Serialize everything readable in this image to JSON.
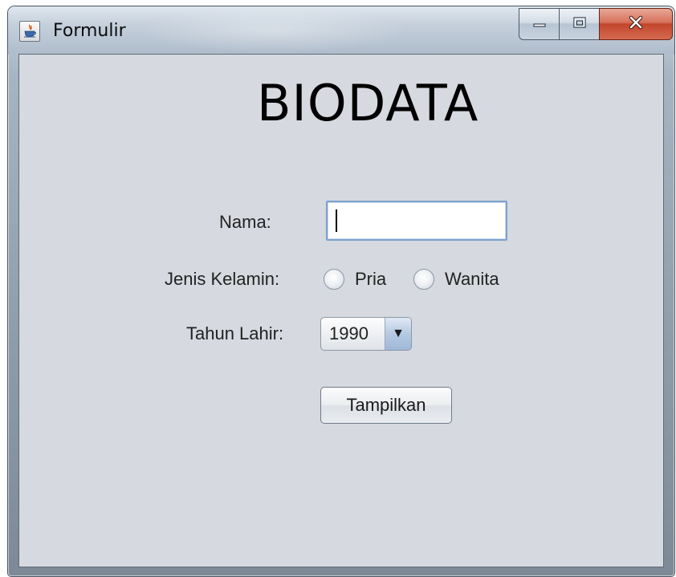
{
  "window": {
    "title": "Formulir",
    "app_icon": "java-cup-icon",
    "caption_buttons": [
      "minimize-icon",
      "maximize-icon",
      "close-icon"
    ],
    "colors": {
      "close": "#c2452b",
      "client_bg": "#d6d9df",
      "input_focus": "#7da2ce"
    }
  },
  "form": {
    "heading": "BIODATA",
    "name": {
      "label": "Nama:",
      "value": "",
      "placeholder": ""
    },
    "gender": {
      "label": "Jenis Kelamin:",
      "options": [
        {
          "label": "Pria",
          "checked": false
        },
        {
          "label": "Wanita",
          "checked": false
        }
      ]
    },
    "birth_year": {
      "label": "Tahun Lahir:",
      "selected": "1990"
    },
    "submit_label": "Tampilkan"
  }
}
